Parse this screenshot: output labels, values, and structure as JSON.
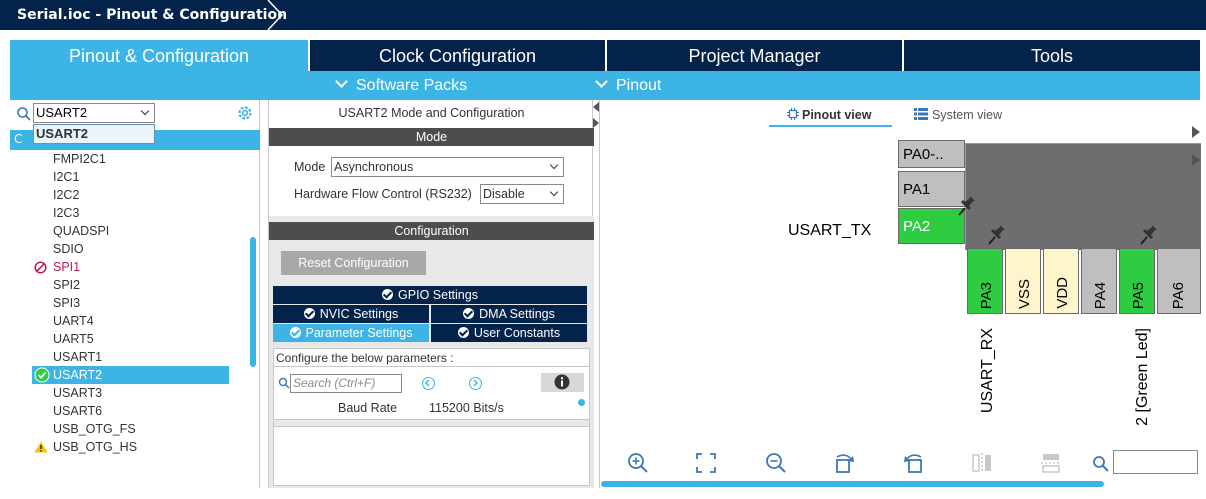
{
  "window": {
    "breadcrumb": "Serial.ioc - Pinout & Configuration"
  },
  "tabs": [
    {
      "label": "Pinout & Configuration",
      "active": true
    },
    {
      "label": "Clock Configuration",
      "active": false
    },
    {
      "label": "Project Manager",
      "active": false
    },
    {
      "label": "Tools",
      "active": false
    }
  ],
  "subbar": {
    "software_packs": "Software Packs",
    "pinout": "Pinout"
  },
  "left": {
    "search_value": "USART2",
    "dropdown_option": "USART2",
    "category_label": "C",
    "items": [
      {
        "label": "FMPI2C1",
        "state": "normal"
      },
      {
        "label": "I2C1",
        "state": "normal"
      },
      {
        "label": "I2C2",
        "state": "normal"
      },
      {
        "label": "I2C3",
        "state": "normal"
      },
      {
        "label": "QUADSPI",
        "state": "normal"
      },
      {
        "label": "SDIO",
        "state": "normal"
      },
      {
        "label": "SPI1",
        "state": "disabled"
      },
      {
        "label": "SPI2",
        "state": "normal"
      },
      {
        "label": "SPI3",
        "state": "normal"
      },
      {
        "label": "UART4",
        "state": "normal"
      },
      {
        "label": "UART5",
        "state": "normal"
      },
      {
        "label": "USART1",
        "state": "normal"
      },
      {
        "label": "USART2",
        "state": "selected"
      },
      {
        "label": "USART3",
        "state": "normal"
      },
      {
        "label": "USART6",
        "state": "normal"
      },
      {
        "label": "USB_OTG_FS",
        "state": "normal"
      },
      {
        "label": "USB_OTG_HS",
        "state": "warning"
      }
    ]
  },
  "middle": {
    "title": "USART2 Mode and Configuration",
    "mode_header": "Mode",
    "mode_label": "Mode",
    "mode_value": "Asynchronous",
    "hwfc_label": "Hardware Flow Control (RS232)",
    "hwfc_value": "Disable",
    "config_header": "Configuration",
    "reset_button": "Reset Configuration",
    "settings_tabs": {
      "gpio": "GPIO Settings",
      "nvic": "NVIC Settings",
      "dma": "DMA Settings",
      "parameter": "Parameter Settings",
      "user_constants": "User Constants"
    },
    "params_header": "Configure the below parameters :",
    "search_placeholder": "Search (Ctrl+F)",
    "baud_label": "Baud Rate",
    "baud_value": "115200 Bits/s"
  },
  "right": {
    "pinout_view": "Pinout view",
    "system_view": "System view",
    "pins_left": [
      {
        "name": "PA0-..",
        "color": "gray"
      },
      {
        "name": "PA1",
        "color": "gray"
      },
      {
        "name": "PA2",
        "color": "green"
      }
    ],
    "pins_bottom": [
      {
        "name": "PA3",
        "color": "green"
      },
      {
        "name": "VSS",
        "color": "cream"
      },
      {
        "name": "VDD",
        "color": "cream"
      },
      {
        "name": "PA4",
        "color": "gray"
      },
      {
        "name": "PA5",
        "color": "green"
      },
      {
        "name": "PA6",
        "color": "gray"
      }
    ],
    "signal_tx": "USART_TX",
    "signal_rx": "USART_RX",
    "signal_led": "2 [Green Led]"
  },
  "colors": {
    "navy": "#03234b",
    "accent": "#3cb4e6",
    "pin_green": "#2ecc40",
    "pin_gray": "#bfbfbf",
    "pin_cream": "#fff5cc",
    "disabled_pink": "#c2185b"
  }
}
